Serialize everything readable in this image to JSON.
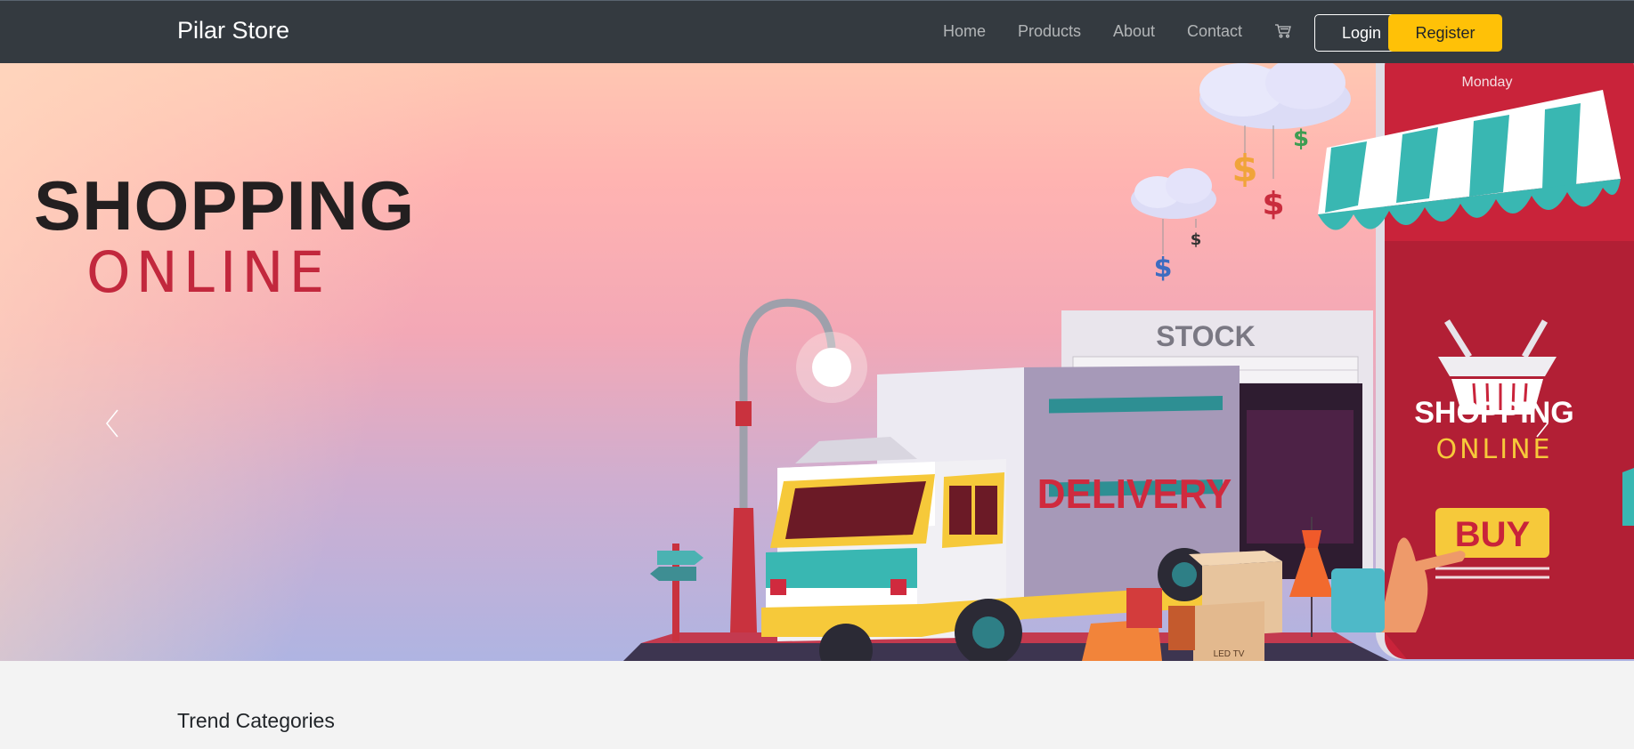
{
  "navbar": {
    "brand": "Pilar Store",
    "links": [
      {
        "label": "Home"
      },
      {
        "label": "Products"
      },
      {
        "label": "About"
      },
      {
        "label": "Contact"
      }
    ],
    "cart_icon": "cart-icon",
    "login_label": "Login",
    "register_label": "Register"
  },
  "hero": {
    "headline_line1": "SHOPPING",
    "headline_line2": "ONLINE",
    "banner": {
      "stock_sign": "STOCK",
      "truck_text": "DELIVERY",
      "phone_day": "Monday",
      "phone_title_1": "SHOPPING",
      "phone_title_2": "ONLINE",
      "buy_label": "BUY",
      "box_label": "LED TV"
    },
    "prev_icon": "chevron-left-icon",
    "next_icon": "chevron-right-icon"
  },
  "sections": {
    "trend_title": "Trend Categories"
  },
  "colors": {
    "navbar_bg": "#343a40",
    "accent_yellow": "#ffc107",
    "headline_dark": "#231f20",
    "headline_red": "#c2283d"
  }
}
